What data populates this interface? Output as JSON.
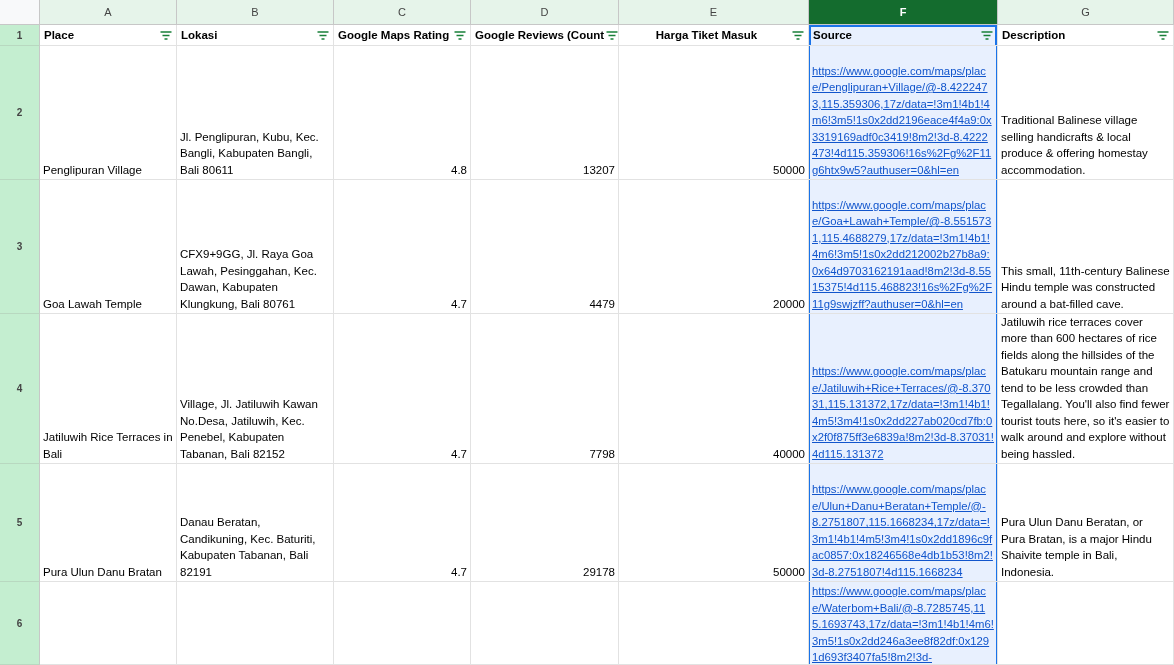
{
  "columns": [
    {
      "letter": "A",
      "selected": false
    },
    {
      "letter": "B",
      "selected": false
    },
    {
      "letter": "C",
      "selected": false
    },
    {
      "letter": "D",
      "selected": false
    },
    {
      "letter": "E",
      "selected": false
    },
    {
      "letter": "F",
      "selected": true
    },
    {
      "letter": "G",
      "selected": false
    }
  ],
  "header_row": {
    "number": "1",
    "cells": [
      {
        "label": "Place",
        "kind": "plain"
      },
      {
        "label": "Lokasi",
        "kind": "plain"
      },
      {
        "label": "Google Maps Rating",
        "kind": "plain"
      },
      {
        "label": "Google Reviews (Count",
        "kind": "plain"
      },
      {
        "label": "Harga Tiket Masuk",
        "kind": "centered"
      },
      {
        "label": "Source",
        "kind": "plain"
      },
      {
        "label": "Description",
        "kind": "plain"
      }
    ]
  },
  "rows": [
    {
      "number": "2",
      "cells": [
        {
          "kind": "text",
          "text": "Penglipuran Village"
        },
        {
          "kind": "text",
          "text": "Jl. Penglipuran, Kubu, Kec. Bangli, Kabupaten Bangli, Bali 80611"
        },
        {
          "kind": "number",
          "text": "4.8"
        },
        {
          "kind": "number",
          "text": "13207"
        },
        {
          "kind": "number",
          "text": "50000"
        },
        {
          "kind": "link",
          "text": "https://www.google.com/maps/place/Penglipuran+Village/@-8.4222473,115.359306,17z/data=!3m1!4b1!4m6!3m5!1s0x2dd2196eace4f4a9:0x3319169adf0c3419!8m2!3d-8.4222473!4d115.359306!16s%2Fg%2F11g6htx9w5?authuser=0&hl=en"
        },
        {
          "kind": "text",
          "text": "Traditional Balinese village selling handicrafts & local produce & offering homestay accommodation."
        }
      ]
    },
    {
      "number": "3",
      "cells": [
        {
          "kind": "text",
          "text": "Goa Lawah Temple"
        },
        {
          "kind": "text",
          "text": "CFX9+9GG, Jl. Raya Goa Lawah, Pesinggahan, Kec. Dawan, Kabupaten Klungkung, Bali 80761"
        },
        {
          "kind": "number",
          "text": "4.7"
        },
        {
          "kind": "number",
          "text": "4479"
        },
        {
          "kind": "number",
          "text": "20000"
        },
        {
          "kind": "link",
          "text": "https://www.google.com/maps/place/Goa+Lawah+Temple/@-8.5515731,115.4688279,17z/data=!3m1!4b1!4m6!3m5!1s0x2dd212002b27b8a9:0x64d9703162191aad!8m2!3d-8.5515375!4d115.468823!16s%2Fg%2F11g9swjzff?authuser=0&hl=en"
        },
        {
          "kind": "text",
          "text": "This small, 11th-century Balinese Hindu temple was constructed around a bat-filled cave."
        }
      ]
    },
    {
      "number": "4",
      "cells": [
        {
          "kind": "text",
          "text": "Jatiluwih Rice Terraces in Bali"
        },
        {
          "kind": "text",
          "text": "Village, Jl. Jatiluwih Kawan No.Desa, Jatiluwih, Kec. Penebel, Kabupaten Tabanan, Bali 82152"
        },
        {
          "kind": "number",
          "text": "4.7"
        },
        {
          "kind": "number",
          "text": "7798"
        },
        {
          "kind": "number",
          "text": "40000"
        },
        {
          "kind": "link",
          "text": "https://www.google.com/maps/place/Jatiluwih+Rice+Terraces/@-8.37031,115.131372,17z/data=!3m1!4b1!4m5!3m4!1s0x2dd227ab020cd7fb:0x2f0f875ff3e6839a!8m2!3d-8.37031!4d115.131372"
        },
        {
          "kind": "text",
          "text": "Jatiluwih rice terraces cover more than 600 hectares of rice fields along the hillsides of the Batukaru mountain range and tend to be less crowded than Tegallalang. You'll also find fewer tourist touts here, so it's easier to walk around and explore without being hassled."
        }
      ]
    },
    {
      "number": "5",
      "cells": [
        {
          "kind": "text",
          "text": "Pura Ulun Danu Bratan"
        },
        {
          "kind": "text",
          "text": "Danau Beratan, Candikuning, Kec. Baturiti, Kabupaten Tabanan, Bali 82191"
        },
        {
          "kind": "number",
          "text": "4.7"
        },
        {
          "kind": "number",
          "text": "29178"
        },
        {
          "kind": "number",
          "text": "50000"
        },
        {
          "kind": "link",
          "text": "https://www.google.com/maps/place/Ulun+Danu+Beratan+Temple/@-8.2751807,115.1668234,17z/data=!3m1!4b1!4m5!3m4!1s0x2dd1896c9fac0857:0x18246568e4db1b53!8m2!3d-8.2751807!4d115.1668234"
        },
        {
          "kind": "text",
          "text": "Pura Ulun Danu Beratan, or Pura Bratan, is a major Hindu Shaivite temple in Bali, Indonesia."
        }
      ]
    },
    {
      "number": "6",
      "cells": [
        {
          "kind": "empty"
        },
        {
          "kind": "empty"
        },
        {
          "kind": "empty"
        },
        {
          "kind": "empty"
        },
        {
          "kind": "empty"
        },
        {
          "kind": "link",
          "text": "https://www.google.com/maps/place/Waterbom+Bali/@-8.7285745,115.1693743,17z/data=!3m1!4b1!4m6!3m5!1s0x2dd246a3ee8f82df:0x1291d693f3407fa5!8m2!3d-"
        },
        {
          "kind": "empty"
        }
      ]
    }
  ]
}
